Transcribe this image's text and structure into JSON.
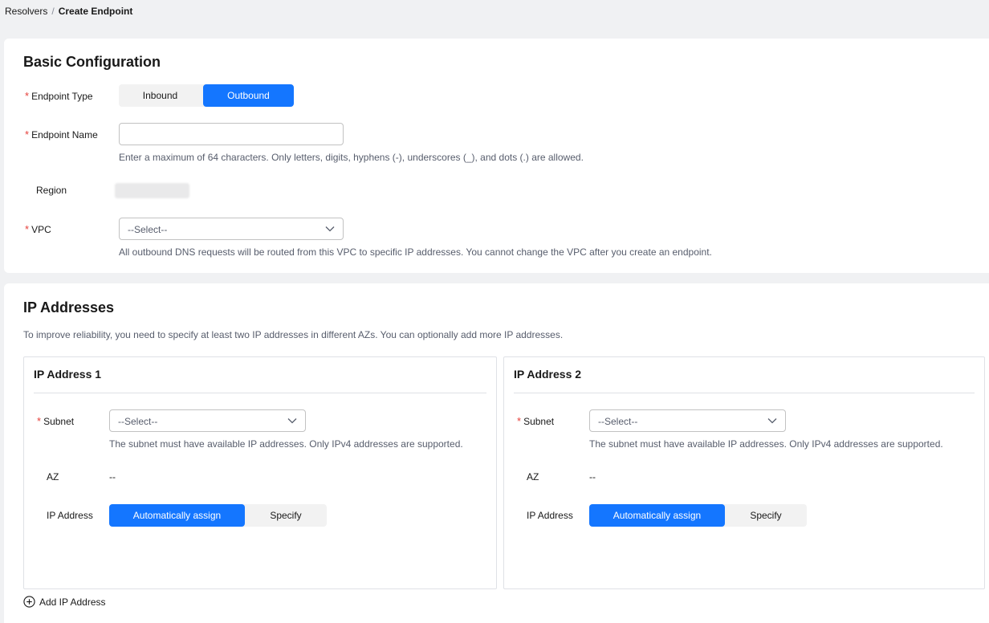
{
  "breadcrumb": {
    "parent": "Resolvers",
    "separator": "/",
    "current": "Create Endpoint"
  },
  "basic": {
    "title": "Basic Configuration",
    "endpoint_type": {
      "label": "Endpoint Type",
      "options": [
        "Inbound",
        "Outbound"
      ],
      "selected": "Outbound"
    },
    "endpoint_name": {
      "label": "Endpoint Name",
      "value": "",
      "placeholder": "",
      "hint": "Enter a maximum of 64 characters. Only letters, digits, hyphens (-), underscores (_), and dots (.) are allowed."
    },
    "region": {
      "label": "Region"
    },
    "vpc": {
      "label": "VPC",
      "value": "--Select--",
      "hint": "All outbound DNS requests will be routed from this VPC to specific IP addresses. You cannot change the VPC after you create an endpoint."
    }
  },
  "ip": {
    "title": "IP Addresses",
    "description": "To improve reliability, you need to specify at least two IP addresses in different AZs. You can optionally add more IP addresses.",
    "cards": [
      {
        "title": "IP Address 1",
        "subnet_label": "Subnet",
        "subnet_value": "--Select--",
        "subnet_hint": "The subnet must have available IP addresses. Only IPv4 addresses are supported.",
        "az_label": "AZ",
        "az_value": "--",
        "ip_label": "IP Address",
        "ip_options": [
          "Automatically assign",
          "Specify"
        ],
        "ip_selected": "Automatically assign"
      },
      {
        "title": "IP Address 2",
        "subnet_label": "Subnet",
        "subnet_value": "--Select--",
        "subnet_hint": "The subnet must have available IP addresses. Only IPv4 addresses are supported.",
        "az_label": "AZ",
        "az_value": "--",
        "ip_label": "IP Address",
        "ip_options": [
          "Automatically assign",
          "Specify"
        ],
        "ip_selected": "Automatically assign"
      }
    ],
    "add_label": "Add IP Address"
  },
  "colors": {
    "primary": "#1476ff",
    "required": "#e6403b",
    "hint": "#575d6c"
  },
  "icons": {
    "select_chevron": "chevron-down-icon",
    "add": "plus-circle-icon"
  }
}
